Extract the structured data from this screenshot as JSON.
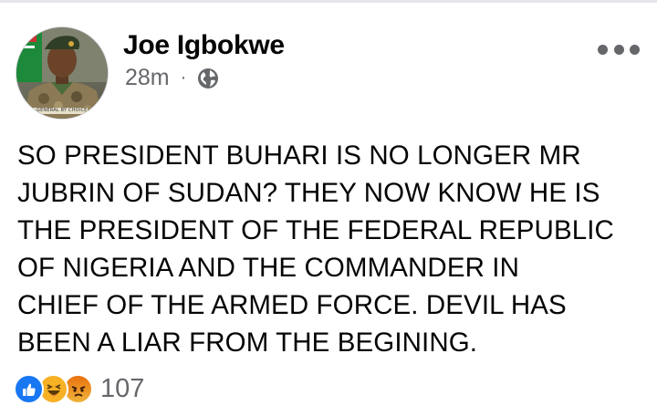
{
  "post": {
    "author": "Joe Igbokwe",
    "time": "28m",
    "separator": "·",
    "privacy_icon": "globe-icon",
    "more_icon": "more-horizontal-icon",
    "body_lines": [
      "SO PRESIDENT BUHARI IS NO LONGER MR",
      "JUBRIN OF SUDAN? THEY NOW KNOW HE IS",
      "THE PRESIDENT OF THE FEDERAL REPUBLIC",
      "OF NIGERIA AND THE COMMANDER IN",
      "CHIEF OF THE ARMED FORCE. DEVIL HAS",
      "BEEN A LIAR FROM THE BEGINING."
    ],
    "avatar_badge": "GENERAL BY CHOICE"
  },
  "reactions": {
    "icons": [
      "like-icon",
      "haha-icon",
      "angry-icon"
    ],
    "count": "107"
  },
  "colors": {
    "author_text": "#050505",
    "meta_text": "#65676b",
    "like_blue": "#1877f2",
    "haha_yellow": "#f7b125",
    "angry_orange": "#e9710f"
  }
}
